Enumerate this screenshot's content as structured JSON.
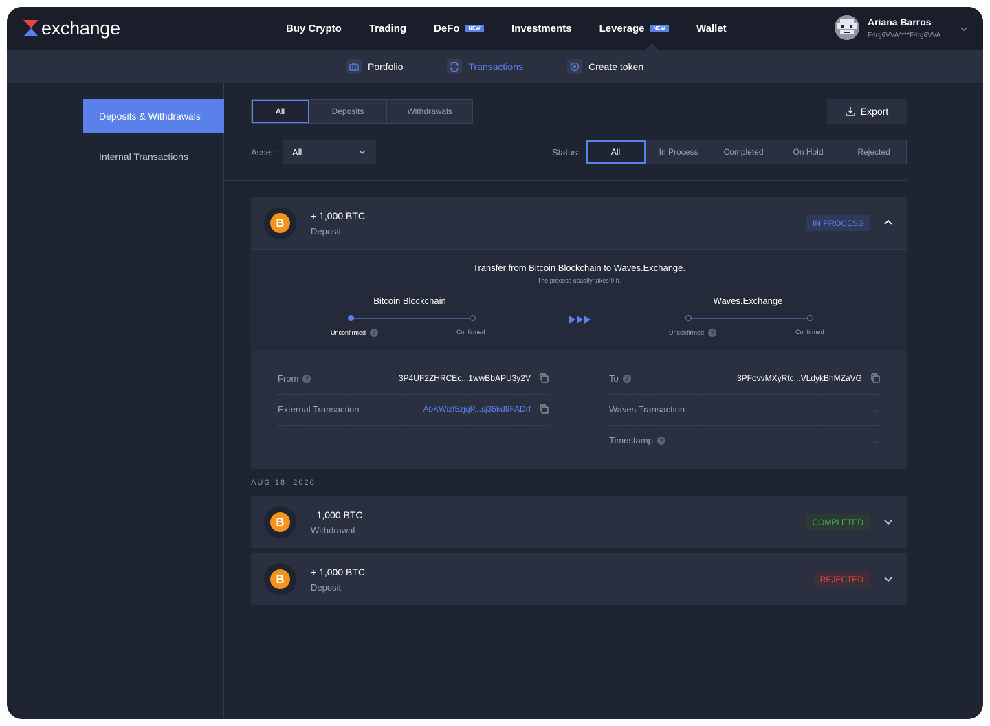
{
  "brand": {
    "logo_text": "exchange",
    "accent": "#5a81ea",
    "logo_red": "#e3473d"
  },
  "nav": {
    "items": [
      {
        "label": "Buy Crypto",
        "badge": ""
      },
      {
        "label": "Trading",
        "badge": ""
      },
      {
        "label": "DeFo",
        "badge": "NEW"
      },
      {
        "label": "Investments",
        "badge": ""
      },
      {
        "label": "Leverage",
        "badge": "NEW"
      },
      {
        "label": "Wallet",
        "badge": ""
      }
    ]
  },
  "user": {
    "name": "Ariana Barros",
    "address": "F4rg6VVA****F4rg6VVA"
  },
  "subnav": {
    "items": [
      {
        "label": "Portfolio",
        "icon": "briefcase-icon"
      },
      {
        "label": "Transactions",
        "icon": "transfer-icon",
        "active": true
      },
      {
        "label": "Create token",
        "icon": "target-icon"
      }
    ]
  },
  "sidebar": {
    "items": [
      {
        "label": "Deposits & Withdrawals",
        "active": true
      },
      {
        "label": "Internal Transactions"
      }
    ]
  },
  "tabs": {
    "items": [
      "All",
      "Deposits",
      "Withdrawals"
    ],
    "selected": "All"
  },
  "export_label": "Export",
  "filters": {
    "asset_label": "Asset:",
    "asset_value": "All",
    "status_label": "Status:",
    "status_items": [
      "All",
      "In Process",
      "Completed",
      "On Hold",
      "Rejected"
    ],
    "status_selected": "All"
  },
  "transactions": [
    {
      "amount": "+ 1,000 BTC",
      "type": "Deposit",
      "status": "IN PROCESS",
      "status_color": "#5a81ea",
      "expanded": true
    },
    {
      "amount": "- 1,000 BTC",
      "type": "Withdrawal",
      "status": "COMPLETED",
      "status_color": "#45b054"
    },
    {
      "amount": "+ 1,000 BTC",
      "type": "Deposit",
      "status": "REJECTED",
      "status_color": "#e3473d"
    }
  ],
  "progress": {
    "title": "Transfer from Bitcoin Blockchain to Waves.Exchange.",
    "subtitle": "The process usually takes 9 h.",
    "source": {
      "name": "Bitcoin Blockchain",
      "step1": "Unconfirmed",
      "step2": "Confirmed"
    },
    "target": {
      "name": "Waves.Exchange",
      "step1": "Unconfirmed",
      "step2": "Confirmed"
    }
  },
  "details": {
    "from_label": "From",
    "from_value": "3P4UF2ZHRCEc...1wwBbAPU3y2V",
    "external_label": "External Transaction",
    "external_value": "AbKWizf5zjqP...sj35kd9FADrf",
    "to_label": "To",
    "to_value": "3PFovvMXyRtc...VLdykBhMZaVG",
    "waves_label": "Waves Transaction",
    "waves_value": "...",
    "timestamp_label": "Timestamp",
    "timestamp_value": "..."
  },
  "date_separator": "AUG 18, 2020",
  "coin_symbol": "B"
}
